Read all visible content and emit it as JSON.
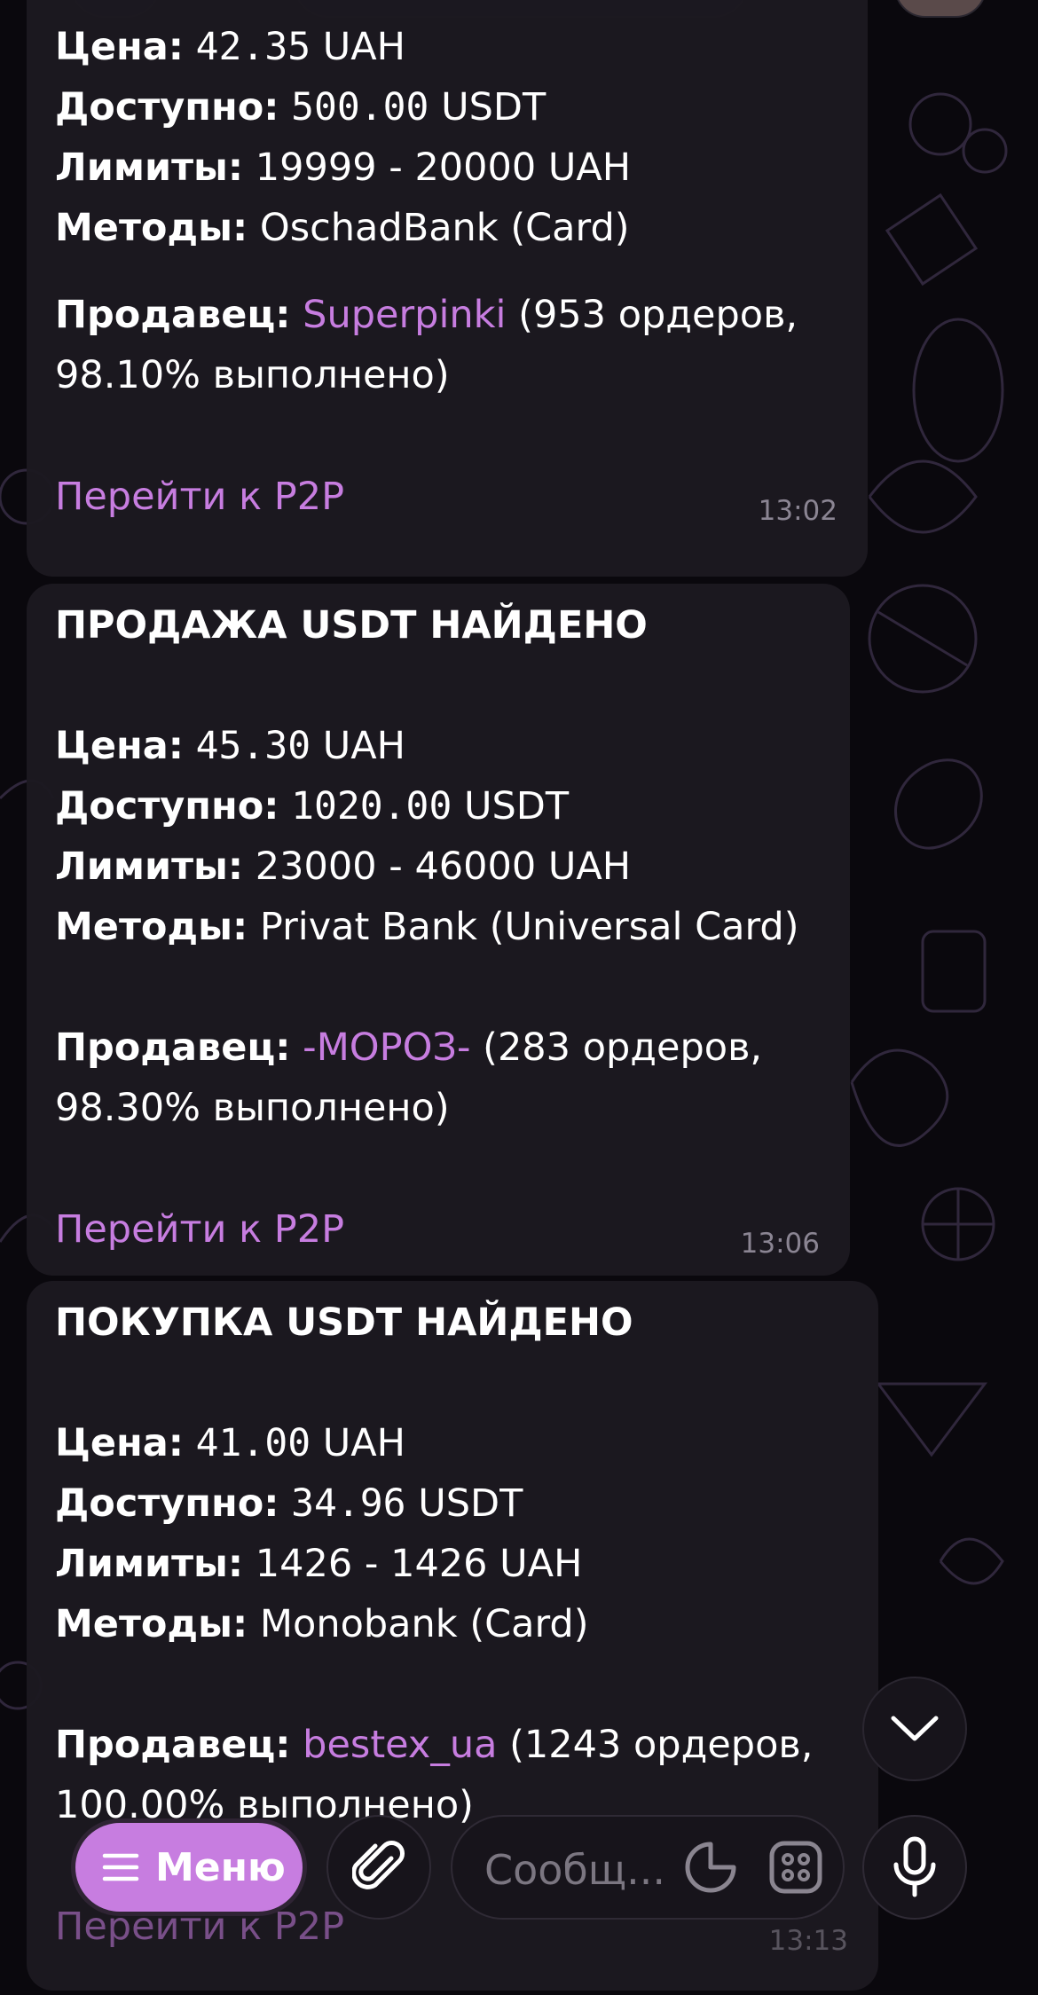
{
  "messages": [
    {
      "price_label": "Цена:",
      "price": "42.35",
      "price_unit": "UAH",
      "available_label": "Доступно:",
      "available": "500.00",
      "available_unit": "USDT",
      "limits_label": "Лимиты:",
      "limits": "19999 - 20000 UAH",
      "methods_label": "Методы:",
      "methods": "OschadBank (Card)",
      "seller_label": "Продавец:",
      "seller": "Superpinki",
      "seller_stats_1": "(953 ордеров,",
      "seller_stats_2": "98.10% выполнено)",
      "link": "Перейти к P2P",
      "time": "13:02"
    },
    {
      "title": "ПРОДАЖА USDT НАЙДЕНО",
      "price_label": "Цена:",
      "price": "45.30",
      "price_unit": "UAH",
      "available_label": "Доступно:",
      "available": "1020.00",
      "available_unit": "USDT",
      "limits_label": "Лимиты:",
      "limits": "23000 - 46000 UAH",
      "methods_label": "Методы:",
      "methods": "Privat Bank (Universal Card)",
      "seller_label": "Продавец:",
      "seller": "-МОРОЗ-",
      "seller_stats_1": "(283 ордеров,",
      "seller_stats_2": "98.30% выполнено)",
      "link": "Перейти к P2P",
      "time": "13:06"
    },
    {
      "title": "ПОКУПКА USDT НАЙДЕНО",
      "price_label": "Цена:",
      "price": "41.00",
      "price_unit": "UAH",
      "available_label": "Доступно:",
      "available": "34.96",
      "available_unit": "USDT",
      "limits_label": "Лимиты:",
      "limits": "1426 - 1426 UAH",
      "methods_label": "Методы:",
      "methods": "Monobank (Card)",
      "seller_label": "Продавец:",
      "seller": "bestex_ua",
      "seller_stats_1": "(1243 ордеров,",
      "seller_stats_2": "100.00% выполнено)",
      "link": "Перейти к P2P",
      "time": "13:13"
    }
  ],
  "composer": {
    "menu_label": "Меню",
    "placeholder": "Сообщ..."
  },
  "icons": [
    "menu-icon",
    "paperclip-icon",
    "sticker-icon",
    "keyboard-icon",
    "microphone-icon",
    "chevron-down-icon"
  ],
  "colors": {
    "accent": "#c77de0",
    "bubble": "#1c1920",
    "background": "#0a080d"
  }
}
